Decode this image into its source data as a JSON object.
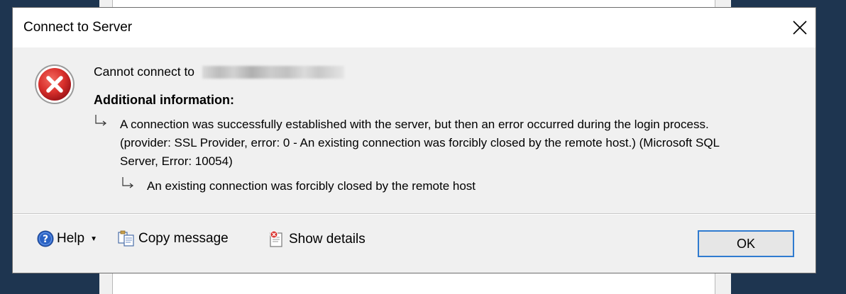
{
  "dialog": {
    "title": "Connect to Server",
    "error": {
      "cannot_connect": "Cannot connect to",
      "additional_heading": "Additional information:",
      "message_primary": "A connection was successfully established with the server, but then an error occurred during the login process. (provider: SSL Provider, error: 0 - An existing connection was forcibly closed by the remote host.) (Microsoft SQL Server, Error: 10054)",
      "message_inner": "An existing connection was forcibly closed by the remote host"
    },
    "footer": {
      "help_label": "Help",
      "copy_label": "Copy message",
      "details_label": "Show details",
      "ok_label": "OK"
    }
  },
  "colors": {
    "desktop": "#1e3550",
    "dialog_bg": "#f0f0f0",
    "error_red": "#d9302c",
    "ok_border": "#2f7bd0"
  },
  "icons": {
    "error": "error-icon",
    "help": "help-icon",
    "copy": "copy-icon",
    "details": "details-icon",
    "close": "close-icon"
  }
}
